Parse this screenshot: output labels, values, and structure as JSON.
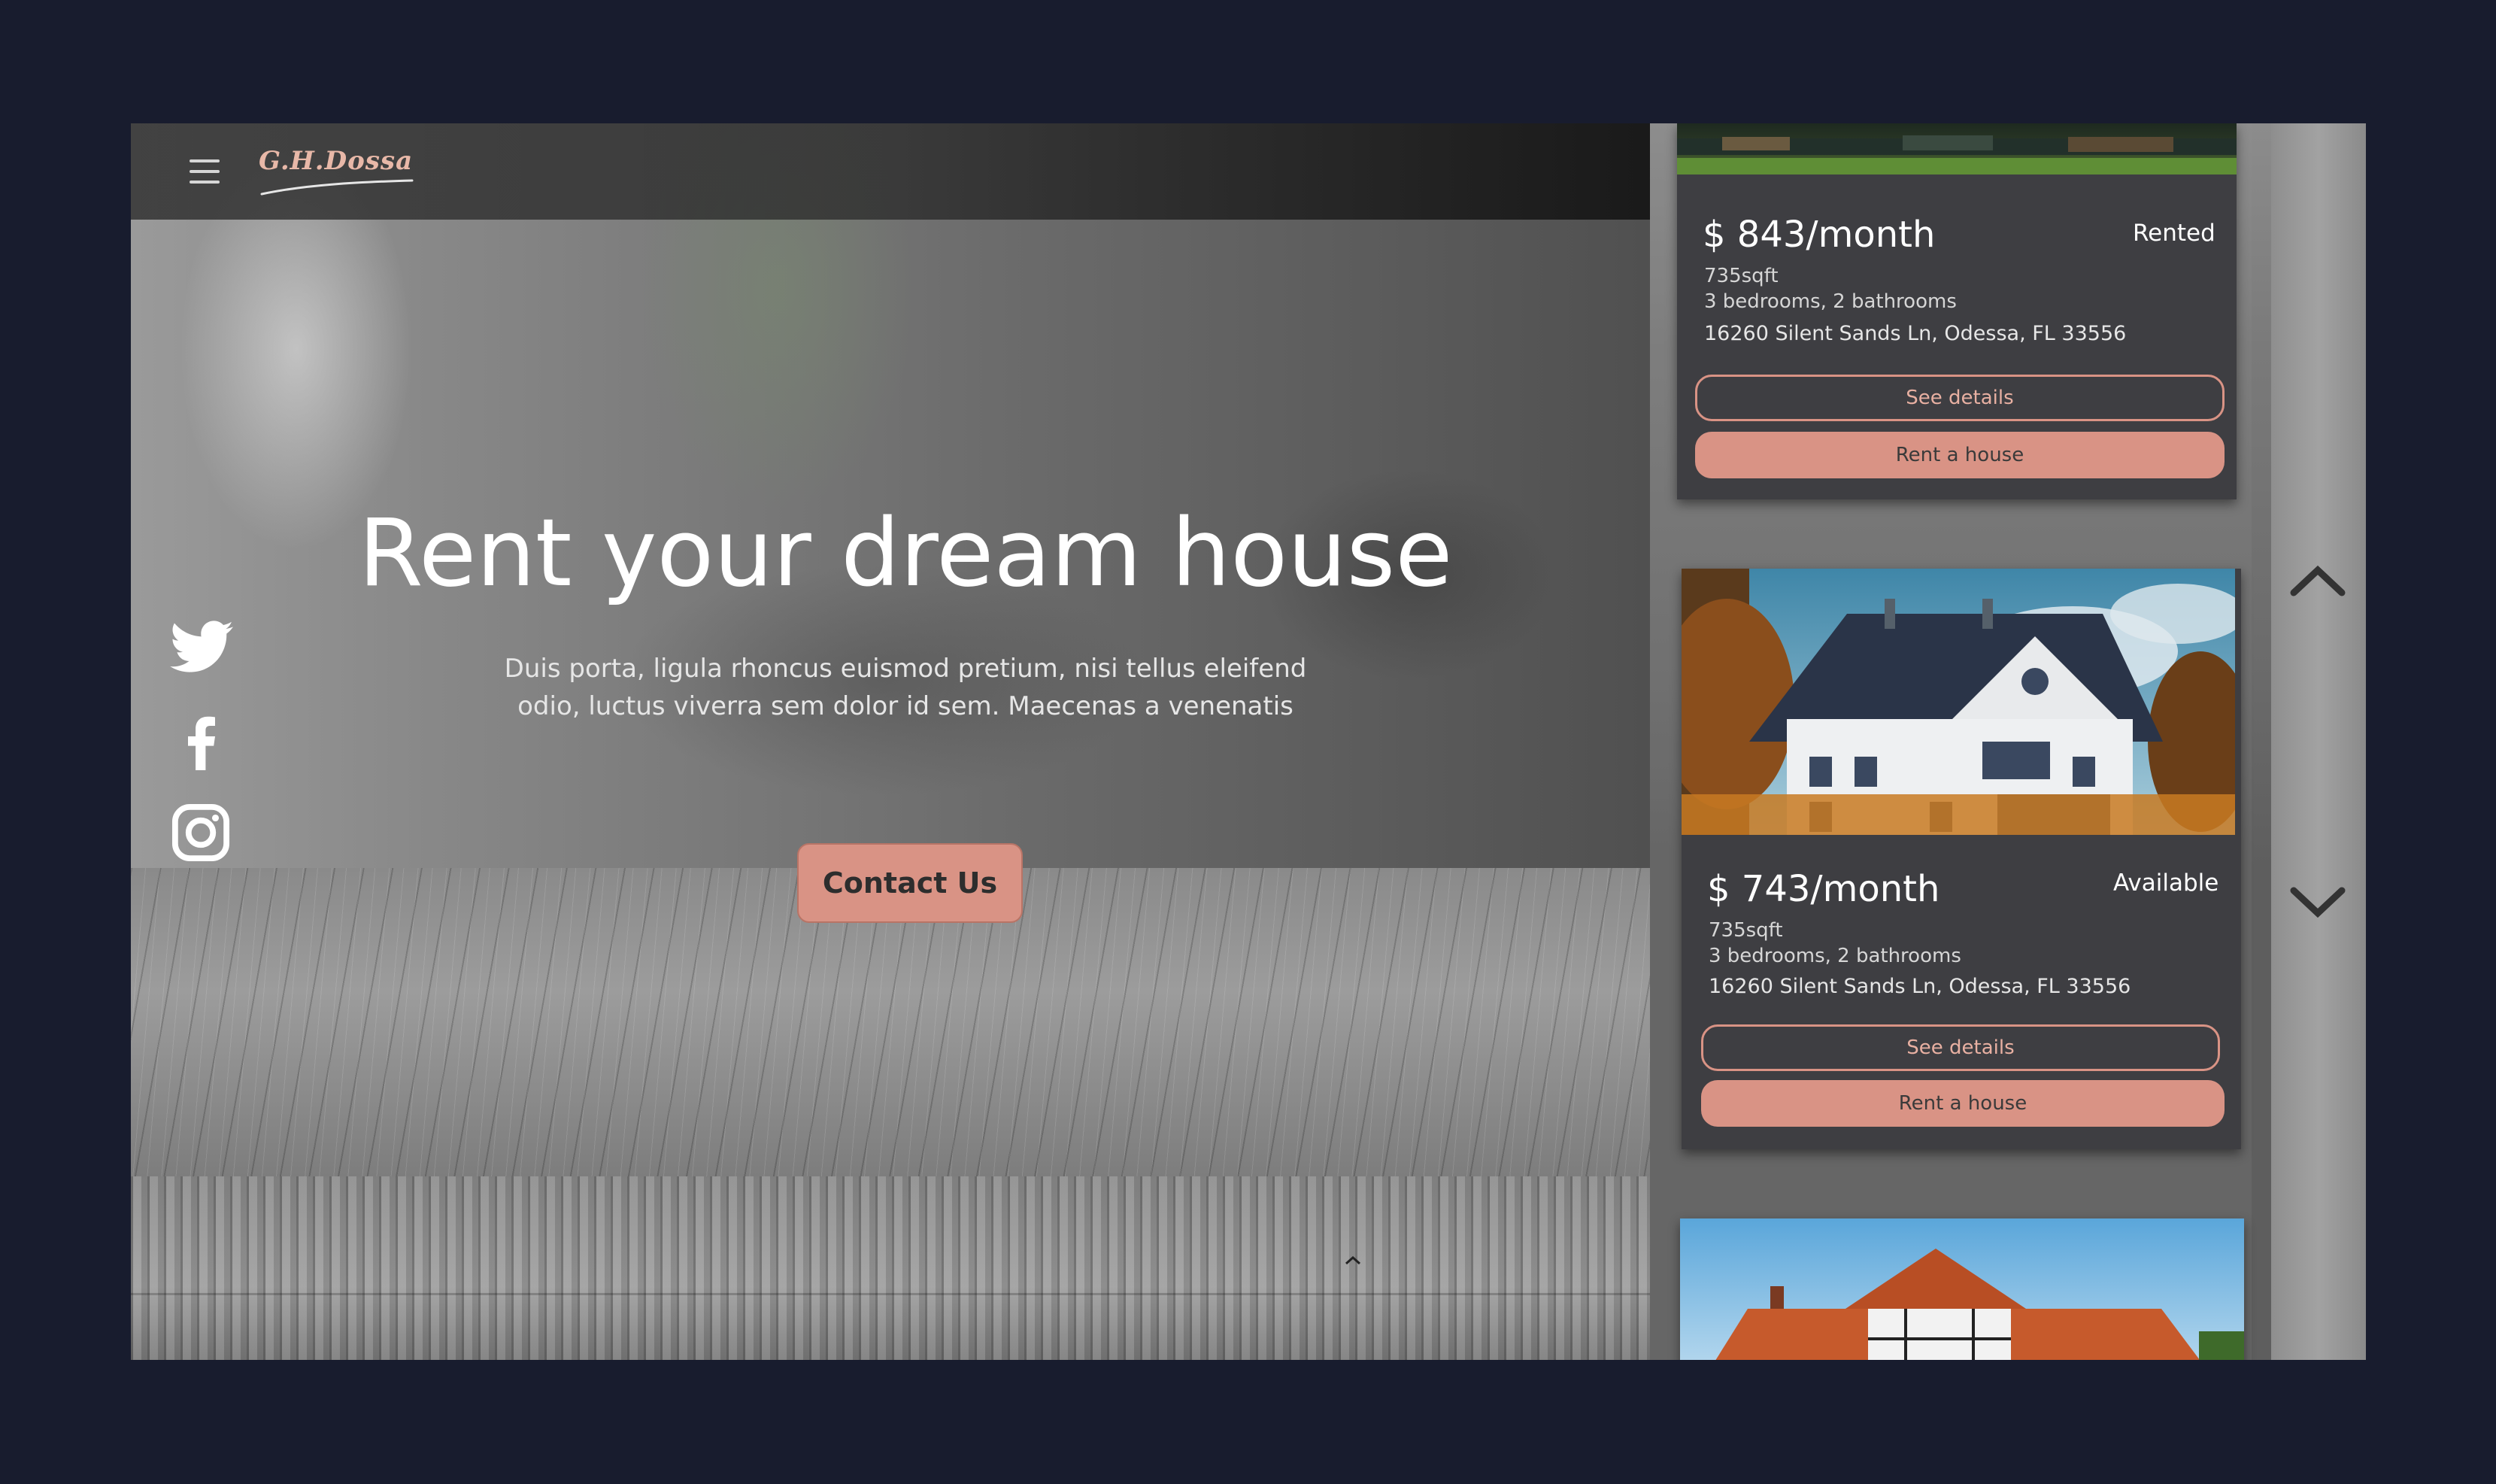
{
  "header": {
    "logo_text": "G.H.Dossa",
    "menu_icon": "hamburger-menu-icon"
  },
  "hero": {
    "title": "Rent your dream house",
    "subtitle_line1": "Duis porta, ligula rhoncus euismod pretium, nisi tellus eleifend",
    "subtitle_line2": "odio, luctus viverra sem dolor id sem. Maecenas a venenatis",
    "contact_label": "Contact Us"
  },
  "social": [
    {
      "name": "twitter-icon"
    },
    {
      "name": "facebook-icon"
    },
    {
      "name": "instagram-icon"
    }
  ],
  "listings": [
    {
      "price": "$ 843/month",
      "status": "Rented",
      "area": "735sqft",
      "rooms": "3 bedrooms, 2 bathrooms",
      "address": "16260 Silent Sands Ln, Odessa, FL 33556",
      "details_label": "See details",
      "rent_label": "Rent a house"
    },
    {
      "price": "$ 743/month",
      "status": "Available",
      "area": "735sqft",
      "rooms": "3 bedrooms, 2 bathrooms",
      "address": "16260 Silent Sands Ln, Odessa, FL 33556",
      "details_label": "See details",
      "rent_label": "Rent a house"
    }
  ],
  "colors": {
    "accent": "#d99385",
    "page_bg": "#181c2e",
    "card_bg": "#3e3e42"
  },
  "icons": {
    "scroll_up": "chevron-up-icon",
    "scroll_down": "chevron-down-icon",
    "back_to_top": "caret-up-icon"
  }
}
